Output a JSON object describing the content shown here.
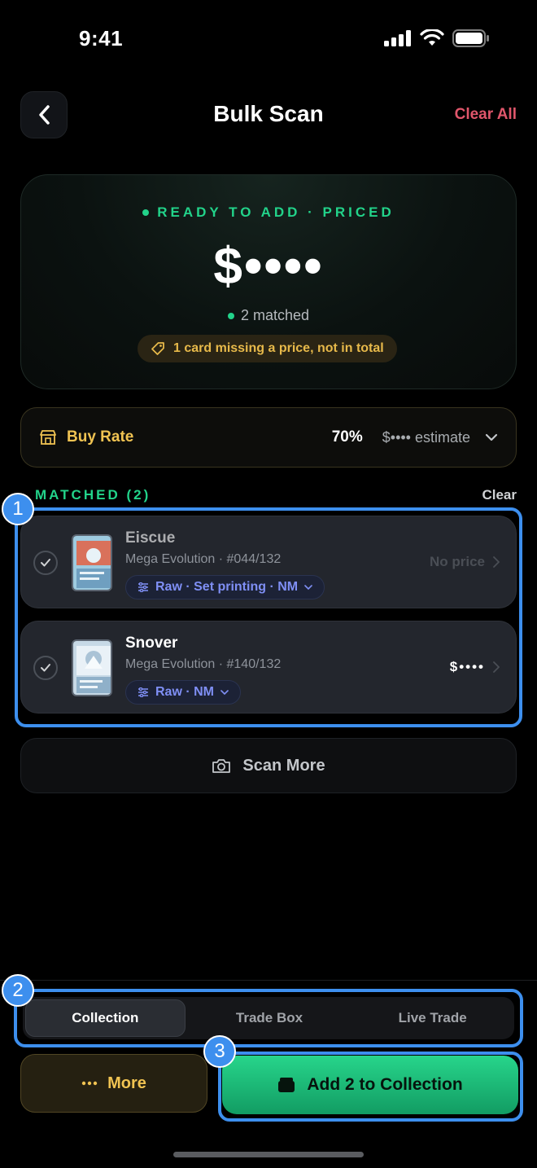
{
  "status_bar": {
    "time": "9:41"
  },
  "header": {
    "title": "Bulk Scan",
    "clear_all": "Clear All"
  },
  "hero": {
    "status": "READY TO ADD · PRICED",
    "amount": "$••••",
    "matched": "2 matched",
    "warning": "1 card missing a price, not in total"
  },
  "buy_rate": {
    "label": "Buy Rate",
    "percent": "70%",
    "estimate": "$•••• estimate"
  },
  "matched_section": {
    "title": "MATCHED (2)",
    "clear": "Clear",
    "items": [
      {
        "name": "Eiscue",
        "set": "Mega Evolution · #044/132",
        "tag": "Raw · Set printing · NM",
        "price": "No price",
        "checked": true
      },
      {
        "name": "Snover",
        "set": "Mega Evolution · #140/132",
        "tag": "Raw · NM",
        "price": "$••••",
        "checked": true
      }
    ]
  },
  "scan_more": "Scan More",
  "destination_tabs": [
    {
      "label": "Collection",
      "active": true
    },
    {
      "label": "Trade Box",
      "active": false
    },
    {
      "label": "Live Trade",
      "active": false
    }
  ],
  "actions": {
    "more": "More",
    "add": "Add 2 to Collection"
  },
  "annotations": [
    "1",
    "2",
    "3"
  ],
  "colors": {
    "accent_green": "#22d38a",
    "gold": "#f0c352",
    "danger": "#e0566b",
    "annotation_blue": "#3d8fee",
    "tag_blue": "#7f8ff5"
  },
  "icons": [
    "back-chevron",
    "store",
    "chevron-down",
    "tag",
    "sliders",
    "check",
    "camera",
    "ellipsis",
    "wallet"
  ]
}
